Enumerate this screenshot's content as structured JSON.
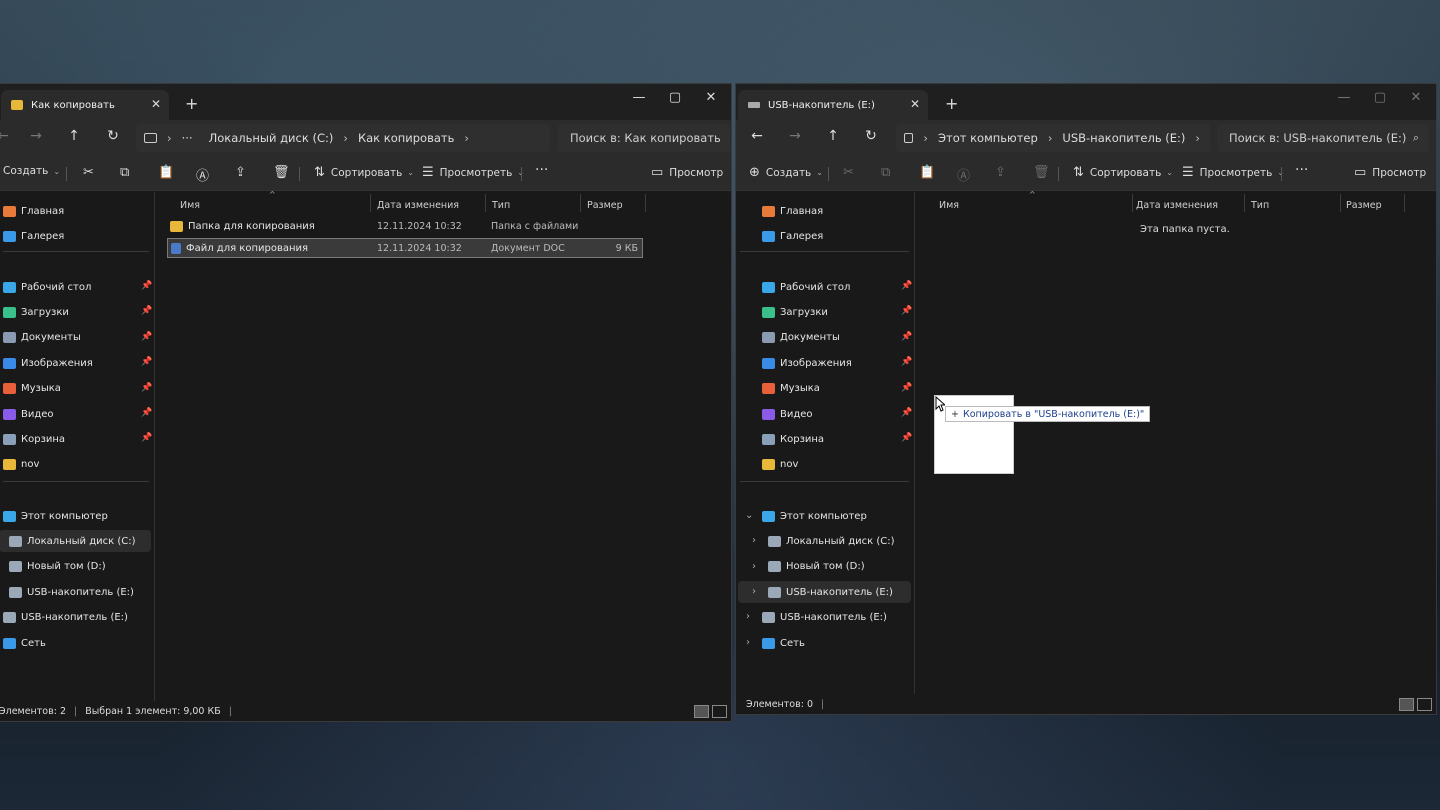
{
  "left": {
    "tab_title": "Как копировать",
    "breadcrumb": [
      "Локальный диск (C:)",
      "Как копировать"
    ],
    "breadcrumb_more": "···",
    "search_placeholder": "Поиск в: Как копировать",
    "toolbar": {
      "create": "Создать",
      "sort": "Сортировать",
      "view": "Просмотреть",
      "more": "···",
      "preview": "Просмотр"
    },
    "columns": [
      "Имя",
      "Дата изменения",
      "Тип",
      "Размер"
    ],
    "files": [
      {
        "name": "Папка для копирования",
        "date": "12.11.2024 10:32",
        "type": "Папка с файлами",
        "size": "",
        "icon": "folder-icon",
        "selected": false
      },
      {
        "name": "Файл для копирования",
        "date": "12.11.2024 10:32",
        "type": "Документ DOC",
        "size": "9 КБ",
        "icon": "doc-icon",
        "selected": true
      }
    ],
    "status": {
      "count": "Элементов: 2",
      "selection": "Выбран 1 элемент: 9,00 КБ"
    }
  },
  "right": {
    "tab_title": "USB-накопитель (E:)",
    "breadcrumb": [
      "Этот компьютер",
      "USB-накопитель (E:)"
    ],
    "search_placeholder": "Поиск в: USB-накопитель (E:)",
    "toolbar": {
      "create": "Создать",
      "sort": "Сортировать",
      "view": "Просмотреть",
      "more": "···",
      "preview": "Просмотр"
    },
    "columns": [
      "Имя",
      "Дата изменения",
      "Тип",
      "Размер"
    ],
    "empty_text": "Эта папка пуста.",
    "status": {
      "count": "Элементов: 0"
    }
  },
  "sidebar": {
    "quick": [
      {
        "label": "Главная",
        "icon": "home-icon",
        "color": "#e87a3a"
      },
      {
        "label": "Галерея",
        "icon": "gallery-icon",
        "color": "#3a9ae8"
      }
    ],
    "pinned": [
      {
        "label": "Рабочий стол",
        "icon": "desktop-icon",
        "color": "#3aa8e8"
      },
      {
        "label": "Загрузки",
        "icon": "downloads-icon",
        "color": "#3ac08a"
      },
      {
        "label": "Документы",
        "icon": "documents-icon",
        "color": "#8a9ab0"
      },
      {
        "label": "Изображения",
        "icon": "pictures-icon",
        "color": "#3a8ae8"
      },
      {
        "label": "Музыка",
        "icon": "music-icon",
        "color": "#e8603a"
      },
      {
        "label": "Видео",
        "icon": "videos-icon",
        "color": "#8a5ae8"
      },
      {
        "label": "Корзина",
        "icon": "recycle-bin-icon",
        "color": "#8aa0b8"
      }
    ],
    "nov": {
      "label": "nov",
      "icon": "folder-icon",
      "color": "#e8b83a"
    },
    "this_pc": "Этот компьютер",
    "drives": [
      "Локальный диск (C:)",
      "Новый том (D:)",
      "USB-накопитель (E:)"
    ],
    "usb_root": "USB-накопитель (E:)",
    "network": "Сеть"
  },
  "drag_tooltip": "Копировать в \"USB-накопитель (E:)\"",
  "drag_tooltip_icon": "+",
  "colors": {
    "window_bg": "#191919",
    "chrome": "#2b2b2b",
    "folder": "#e8b83a",
    "link": "#1b3f8b"
  }
}
